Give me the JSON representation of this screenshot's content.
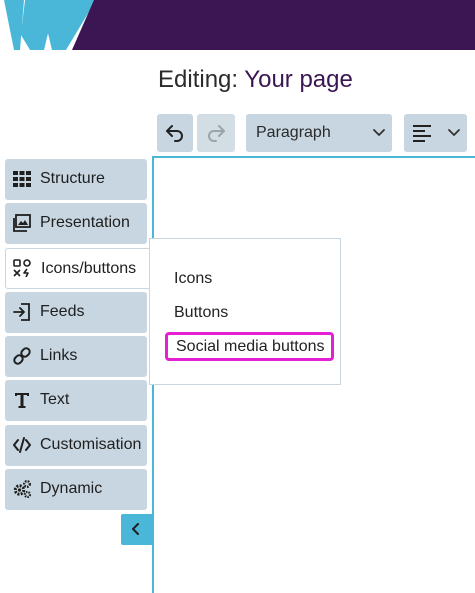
{
  "colors": {
    "brand_purple": "#3b1652",
    "brand_cyan": "#4bb7d8",
    "panel_blue": "#c7d6e0",
    "highlight_magenta": "#e420d5"
  },
  "header": {
    "title_prefix": "Editing: ",
    "title_page": "Your page"
  },
  "toolbar": {
    "undo_icon": "undo-icon",
    "redo_icon": "redo-icon",
    "block_format": "Paragraph",
    "align_icon": "align-left-icon"
  },
  "sidebar": {
    "items": [
      {
        "label": "Structure",
        "icon": "grid-icon"
      },
      {
        "label": "Presentation",
        "icon": "images-icon"
      },
      {
        "label": "Icons/buttons",
        "icon": "icons-buttons-icon"
      },
      {
        "label": "Feeds",
        "icon": "feed-in-icon"
      },
      {
        "label": "Links",
        "icon": "link-icon"
      },
      {
        "label": "Text",
        "icon": "text-icon"
      },
      {
        "label": "Customisation",
        "icon": "code-icon"
      },
      {
        "label": "Dynamic",
        "icon": "cogs-icon"
      }
    ],
    "active_index": 2,
    "collapse_icon": "chevron-left-icon"
  },
  "popover": {
    "items": [
      "Icons",
      "Buttons",
      "Social media buttons"
    ],
    "highlighted_index": 2
  }
}
